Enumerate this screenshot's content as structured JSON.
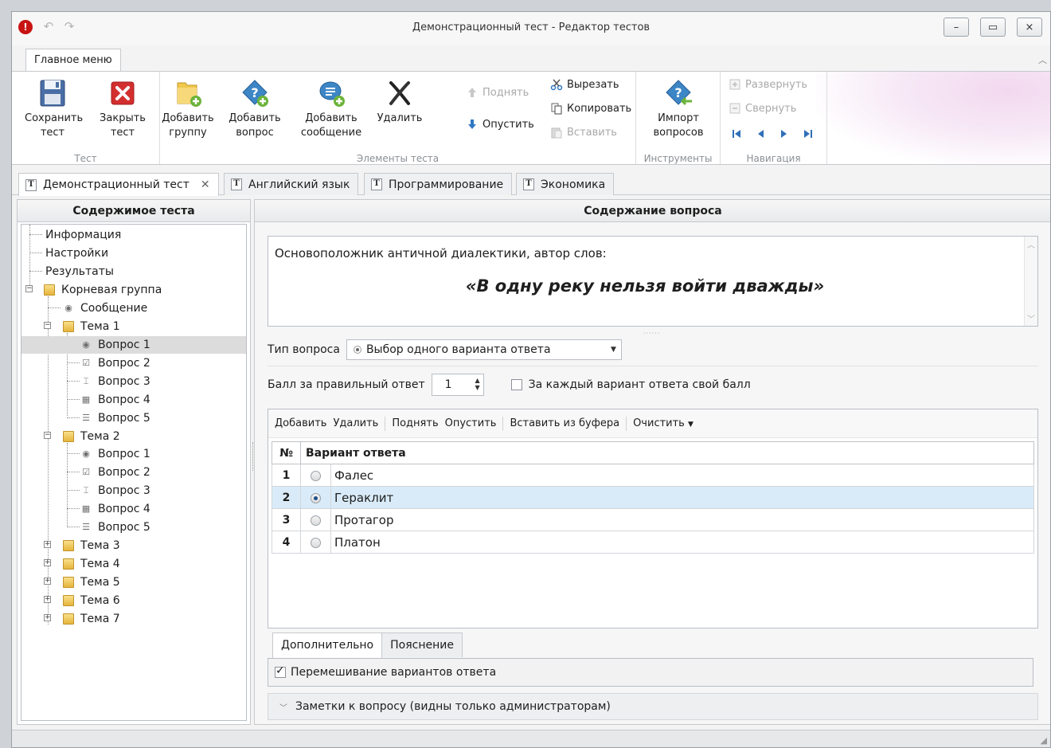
{
  "window": {
    "title": "Демонстрационный тест - Редактор тестов",
    "min_label": "–",
    "max_label": "▭",
    "close_label": "×"
  },
  "ribbon": {
    "tab_label": "Главное меню",
    "groups": {
      "test": "Тест",
      "elements": "Элементы теста",
      "tools": "Инструменты",
      "navigation": "Навигация"
    },
    "buttons": {
      "save_l1": "Сохранить",
      "save_l2": "тест",
      "close_l1": "Закрыть",
      "close_l2": "тест",
      "add_group_l1": "Добавить",
      "add_group_l2": "группу",
      "add_question_l1": "Добавить",
      "add_question_l2": "вопрос",
      "add_message_l1": "Добавить",
      "add_message_l2": "сообщение",
      "delete": "Удалить",
      "move_up": "Поднять",
      "move_down": "Опустить",
      "cut": "Вырезать",
      "copy": "Копировать",
      "paste": "Вставить",
      "import_l1": "Импорт",
      "import_l2": "вопросов",
      "expand": "Развернуть",
      "collapse": "Свернуть"
    }
  },
  "doc_tabs": [
    {
      "label": "Демонстрационный тест",
      "active": true
    },
    {
      "label": "Английский язык"
    },
    {
      "label": "Программирование"
    },
    {
      "label": "Экономика"
    }
  ],
  "left_panel": {
    "title": "Содержимое теста",
    "tree": {
      "info": "Информация",
      "settings": "Настройки",
      "results": "Результаты",
      "root_group": "Корневая группа",
      "message": "Сообщение",
      "topic1": "Тема 1",
      "t1q1": "Вопрос 1",
      "t1q2": "Вопрос 2",
      "t1q3": "Вопрос 3",
      "t1q4": "Вопрос 4",
      "t1q5": "Вопрос 5",
      "topic2": "Тема 2",
      "t2q1": "Вопрос 1",
      "t2q2": "Вопрос 2",
      "t2q3": "Вопрос 3",
      "t2q4": "Вопрос 4",
      "t2q5": "Вопрос 5",
      "topic3": "Тема 3",
      "topic4": "Тема 4",
      "topic5": "Тема 5",
      "topic6": "Тема 6",
      "topic7": "Тема 7"
    }
  },
  "right_panel": {
    "title": "Содержание вопроса",
    "question_line1": "Основоположник античной диалектики, автор слов:",
    "question_line2": "«В одну реку нельзя войти дважды»",
    "type_label": "Тип вопроса",
    "type_value": "Выбор одного варианта ответа",
    "score_label": "Балл за правильный ответ",
    "score_value": "1",
    "per_answer_label": "За каждый вариант ответа свой балл",
    "toolbar": {
      "add": "Добавить",
      "delete": "Удалить",
      "up": "Поднять",
      "down": "Опустить",
      "paste": "Вставить из буфера",
      "clear": "Очистить"
    },
    "grid": {
      "col_num": "№",
      "col_answer": "Вариант ответа",
      "rows": [
        {
          "num": "1",
          "text": "Фалес",
          "selected": false
        },
        {
          "num": "2",
          "text": "Гераклит",
          "selected": true
        },
        {
          "num": "3",
          "text": "Протагор",
          "selected": false
        },
        {
          "num": "4",
          "text": "Платон",
          "selected": false
        }
      ]
    },
    "subtabs": {
      "extra": "Дополнительно",
      "explanation": "Пояснение"
    },
    "shuffle_label": "Перемешивание вариантов ответа",
    "notes_label": "Заметки к вопросу (видны только администраторам)"
  },
  "colors": {
    "accent": "#2b6cb5",
    "selected_row": "#d9ebf8",
    "close_red": "#d32f2f"
  }
}
